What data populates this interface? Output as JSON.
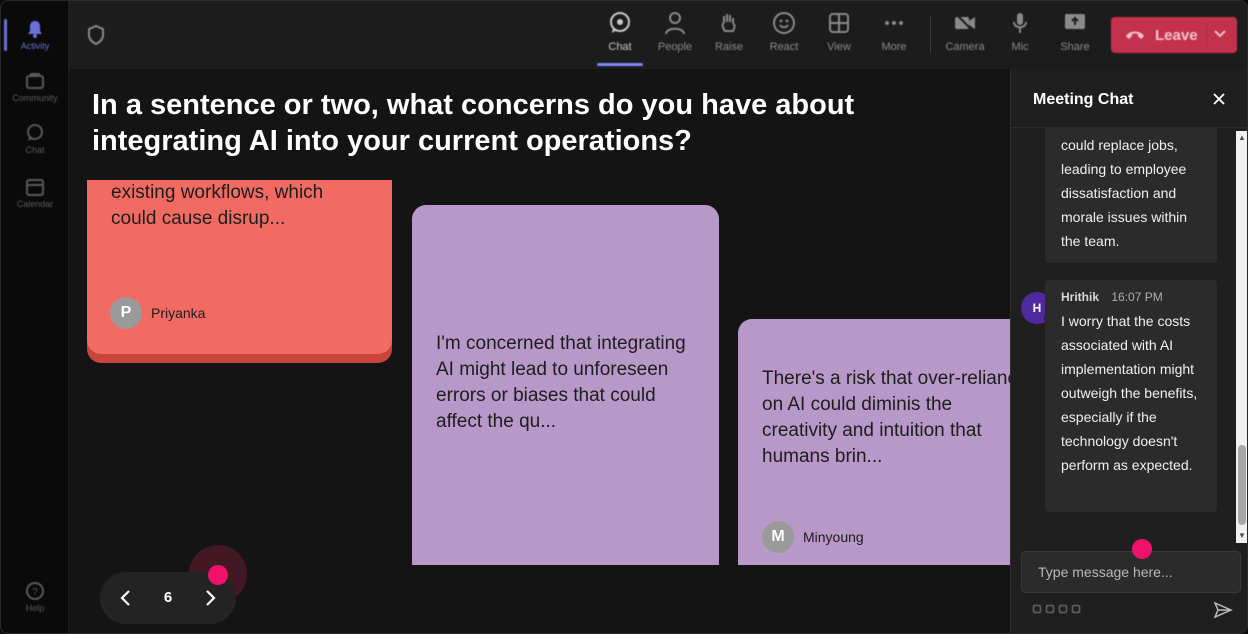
{
  "rail": {
    "items": [
      {
        "label": "Activity",
        "icon": "bell-icon"
      },
      {
        "label": "Community",
        "icon": "community-icon"
      },
      {
        "label": "Chat",
        "icon": "chat-icon"
      },
      {
        "label": "Calendar",
        "icon": "calendar-icon"
      },
      {
        "label": "Help",
        "icon": "help-icon"
      }
    ]
  },
  "toolbar": {
    "chat": "Chat",
    "people": "People",
    "raise": "Raise",
    "react": "React",
    "view": "View",
    "more": "More",
    "camera": "Camera",
    "mic": "Mic",
    "share": "Share",
    "leave": "Leave"
  },
  "stage": {
    "question": "In a sentence or two, what concerns do you have about integrating AI into your current operations?",
    "cards": [
      {
        "text": "existing workflows, which could cause disrup...",
        "author": "Priyanka",
        "initial": "P",
        "color": "#f26b63"
      },
      {
        "text": "I'm concerned that integrating AI might lead to unforeseen errors or biases that could affect the qu...",
        "color": "#b898c8"
      },
      {
        "text": "There's a risk that over-reliance on AI could diminis the creativity and intuition that humans brin...",
        "author": "Minyoung",
        "initial": "M",
        "color": "#b898c8"
      }
    ],
    "page": "6"
  },
  "chat": {
    "title": "Meeting Chat",
    "messages": [
      {
        "text": "could replace jobs, leading to employee dissatisfaction and morale issues within the team."
      },
      {
        "sender": "Hrithik",
        "initial": "H",
        "time": "16:07 PM",
        "text": "I worry that the costs associated with AI implementation might outweigh the benefits, especially if the technology doesn't perform as expected."
      }
    ],
    "input_placeholder": "Type message here..."
  },
  "colors": {
    "accent": "#7f85f5",
    "leave": "#c4314b",
    "cursor": "#f0116a"
  }
}
